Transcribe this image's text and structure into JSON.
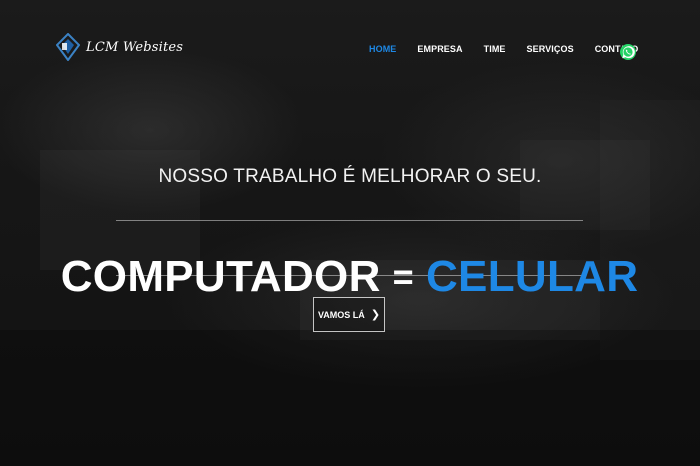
{
  "brand": {
    "name": "LCM Websites",
    "logo_icon": "lcm-diamond-logo"
  },
  "nav": {
    "items": [
      {
        "label": "HOME",
        "active": true
      },
      {
        "label": "EMPRESA",
        "active": false
      },
      {
        "label": "TIME",
        "active": false
      },
      {
        "label": "SERVIÇOS",
        "active": false
      },
      {
        "label": "CONTATO",
        "active": false
      }
    ],
    "whatsapp_icon": "whatsapp-icon"
  },
  "hero": {
    "tagline": "NOSSO TRABALHO É MELHORAR O SEU.",
    "headline_left": "COMPUTADOR",
    "headline_eq": "=",
    "headline_right": "CELULAR",
    "cta_label": "VAMOS LÁ",
    "cta_icon": "chevron-right-icon"
  },
  "colors": {
    "accent": "#1e88e5",
    "text": "#ffffff",
    "whatsapp": "#25d366"
  }
}
